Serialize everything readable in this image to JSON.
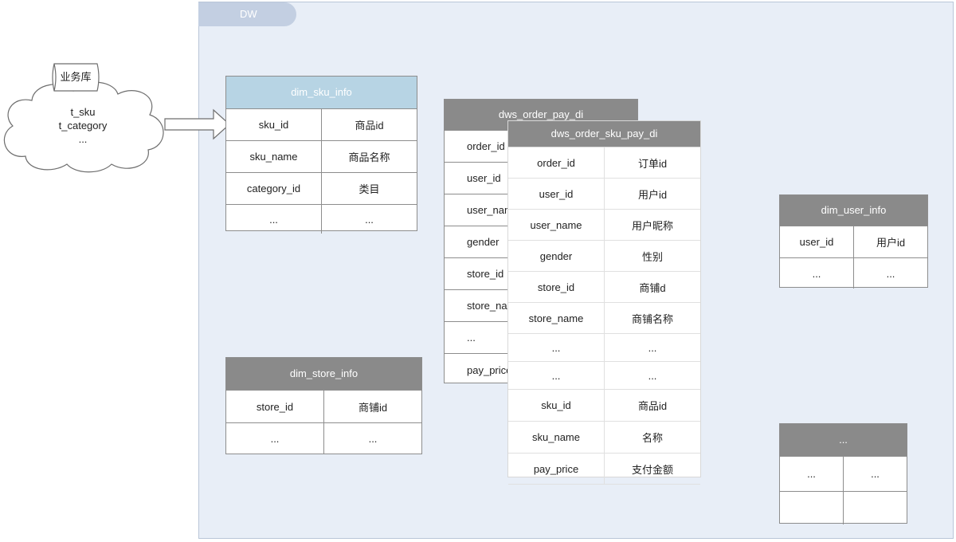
{
  "dw_container": {
    "label": "DW",
    "fill": "#e8eef7"
  },
  "source": {
    "db_label": "业务库",
    "tables": [
      "t_sku",
      "t_category",
      "..."
    ]
  },
  "tables": {
    "dim_sku_info": {
      "title": "dim_sku_info",
      "header_color": "#b7d4e4",
      "rows": [
        [
          "sku_id",
          "商品id"
        ],
        [
          "sku_name",
          "商品名称"
        ],
        [
          "category_id",
          "类目"
        ],
        [
          "...",
          "..."
        ]
      ]
    },
    "dim_store_info": {
      "title": "dim_store_info",
      "header_color": "#8a8a8a",
      "rows": [
        [
          "store_id",
          "商铺id"
        ],
        [
          "...",
          "..."
        ]
      ]
    },
    "dws_order_pay_di": {
      "title": "dws_order_pay_di",
      "header_color": "#8a8a8a",
      "rows": [
        [
          "order_id"
        ],
        [
          "user_id"
        ],
        [
          "user_name"
        ],
        [
          "gender"
        ],
        [
          "store_id"
        ],
        [
          "store_name"
        ],
        [
          "..."
        ],
        [
          "pay_price"
        ]
      ]
    },
    "dws_order_sku_pay_di": {
      "title": "dws_order_sku_pay_di",
      "header_color": "#8a8a8a",
      "rows": [
        [
          "order_id",
          "订单id"
        ],
        [
          "user_id",
          "用户id"
        ],
        [
          "user_name",
          "用户昵称"
        ],
        [
          "gender",
          "性别"
        ],
        [
          "store_id",
          "商铺d"
        ],
        [
          "store_name",
          "商铺名称"
        ],
        [
          "...",
          "..."
        ],
        [
          "...",
          "..."
        ],
        [
          "sku_id",
          "商品id"
        ],
        [
          "sku_name",
          "名称"
        ],
        [
          "pay_price",
          "支付金额"
        ]
      ]
    },
    "dim_user_info": {
      "title": "dim_user_info",
      "header_color": "#8a8a8a",
      "rows": [
        [
          "user_id",
          "用户id"
        ],
        [
          "...",
          "..."
        ]
      ]
    },
    "other": {
      "title": "...",
      "header_color": "#8a8a8a",
      "rows": [
        [
          "...",
          "..."
        ],
        [
          "",
          ""
        ]
      ]
    }
  }
}
